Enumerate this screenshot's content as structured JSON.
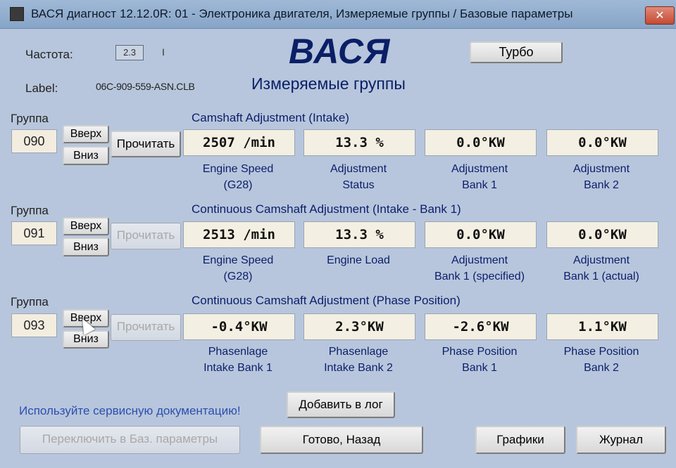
{
  "window": {
    "title": "ВАСЯ диагност 12.12.0R: 01 - Электроника двигателя,  Измеряемые группы / Базовые параметры",
    "close_glyph": "✕"
  },
  "header": {
    "freq_label": "Частота:",
    "freq_value": "2.3",
    "freq_tick": "I",
    "app_name": "ВАСЯ",
    "turbo_label": "Турбо",
    "label_label": "Label:",
    "label_value": "06C-909-559-ASN.CLB",
    "page_title": "Измеряемые группы"
  },
  "groups": [
    {
      "group_label": "Группа",
      "number": "090",
      "up_label": "Вверх",
      "down_label": "Вниз",
      "read_label": "Прочитать",
      "description": "Camshaft Adjustment (Intake)",
      "values": [
        "2507 /min",
        "13.3 %",
        "0.0°KW",
        "0.0°KW"
      ],
      "labels": [
        [
          "Engine Speed",
          "(G28)"
        ],
        [
          "Adjustment",
          "Status"
        ],
        [
          "Adjustment",
          "Bank 1"
        ],
        [
          "Adjustment",
          "Bank 2"
        ]
      ]
    },
    {
      "group_label": "Группа",
      "number": "091",
      "up_label": "Вверх",
      "down_label": "Вниз",
      "read_label": "Прочитать",
      "description": "Continuous Camshaft Adjustment (Intake - Bank 1)",
      "values": [
        "2513 /min",
        "13.3 %",
        "0.0°KW",
        "0.0°KW"
      ],
      "labels": [
        [
          "Engine Speed",
          "(G28)"
        ],
        [
          "Engine Load",
          ""
        ],
        [
          "Adjustment",
          "Bank 1 (specified)"
        ],
        [
          "Adjustment",
          "Bank 1 (actual)"
        ]
      ]
    },
    {
      "group_label": "Группа",
      "number": "093",
      "up_label": "Вверх",
      "down_label": "Вниз",
      "read_label": "Прочитать",
      "description": "Continuous Camshaft Adjustment (Phase Position)",
      "values": [
        "-0.4°KW",
        "2.3°KW",
        "-2.6°KW",
        "1.1°KW"
      ],
      "labels": [
        [
          "Phasenlage",
          "Intake Bank 1"
        ],
        [
          "Phasenlage",
          "Intake Bank 2"
        ],
        [
          "Phase Position",
          "Bank 1"
        ],
        [
          "Phase Position",
          "Bank 2"
        ]
      ]
    }
  ],
  "footer": {
    "hint": "Используйте сервисную документацию!",
    "add_log_label": "Добавить в лог",
    "switch_label": "Переключить в Баз. параметры",
    "done_label": "Готово, Назад",
    "graphs_label": "Графики",
    "journal_label": "Журнал"
  }
}
